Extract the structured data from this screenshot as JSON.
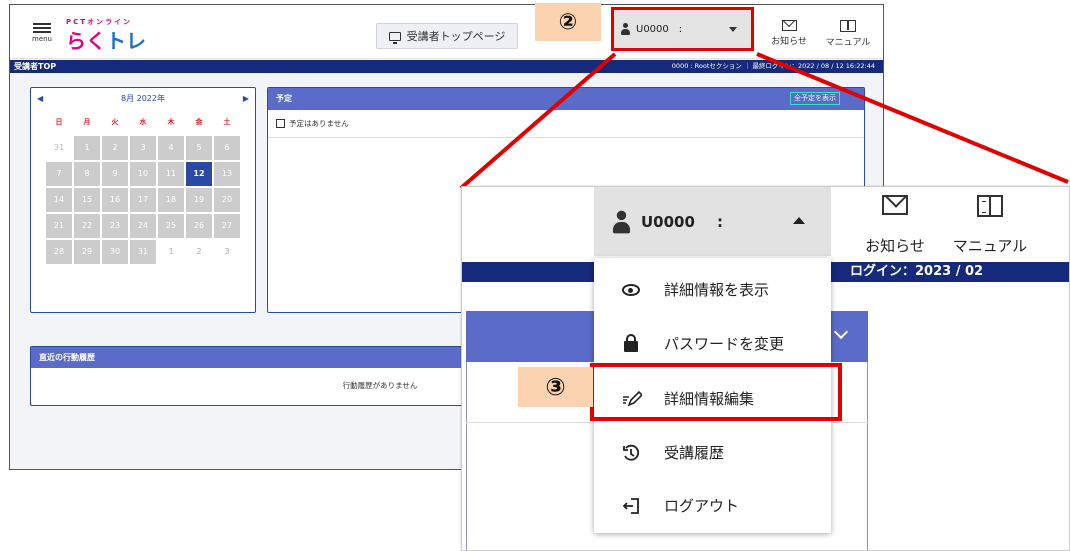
{
  "header": {
    "menu_label": "menu",
    "logo_top": "PCTオンライン",
    "logo_ra": "らく",
    "logo_tore": "トレ",
    "trainee_top_button": "受講者トップページ",
    "user_id": "U0000",
    "user_sep": ":",
    "notice_label": "お知らせ",
    "manual_label": "マニュアル"
  },
  "statusbar": {
    "page_title": "受講者TOP",
    "meta": "0000 : Rootセクション ｜ 最終ログイン：2022 / 08 / 12 16:22:44"
  },
  "calendar": {
    "prev": "◀",
    "next": "▶",
    "month_label": "8月 2022年",
    "weekdays": [
      "日",
      "月",
      "火",
      "水",
      "木",
      "金",
      "土"
    ],
    "days": [
      "31",
      "1",
      "2",
      "3",
      "4",
      "5",
      "6",
      "7",
      "8",
      "9",
      "10",
      "11",
      "12",
      "13",
      "14",
      "15",
      "16",
      "17",
      "18",
      "19",
      "20",
      "21",
      "22",
      "23",
      "24",
      "25",
      "26",
      "27",
      "28",
      "29",
      "30",
      "31",
      "1",
      "2",
      "3"
    ],
    "today": "12"
  },
  "schedule": {
    "title": "予定",
    "show_all": "全予定を表示",
    "empty": "予定はありません"
  },
  "history": {
    "title": "直近の行動履歴",
    "empty": "行動履歴がありません"
  },
  "annotations": {
    "step2": "②",
    "step3": "③"
  },
  "zoom": {
    "user_id": "U0000",
    "user_sep": ":",
    "notice_label": "お知らせ",
    "manual_label": "マニュアル",
    "login_fragment": "ログイン：2023 / 02",
    "menu_items": [
      {
        "icon": "eye-icon",
        "label": "詳細情報を表示"
      },
      {
        "icon": "lock-icon",
        "label": "パスワードを変更"
      },
      {
        "icon": "edit-icon",
        "label": "詳細情報編集"
      },
      {
        "icon": "history-icon",
        "label": "受講履歴"
      },
      {
        "icon": "logout-icon",
        "label": "ログアウト"
      }
    ]
  },
  "colors": {
    "brand_blue": "#152a7a",
    "panel_header": "#5b6bc8",
    "highlight_red": "#e00000",
    "badge_bg": "#fbd3b1"
  }
}
